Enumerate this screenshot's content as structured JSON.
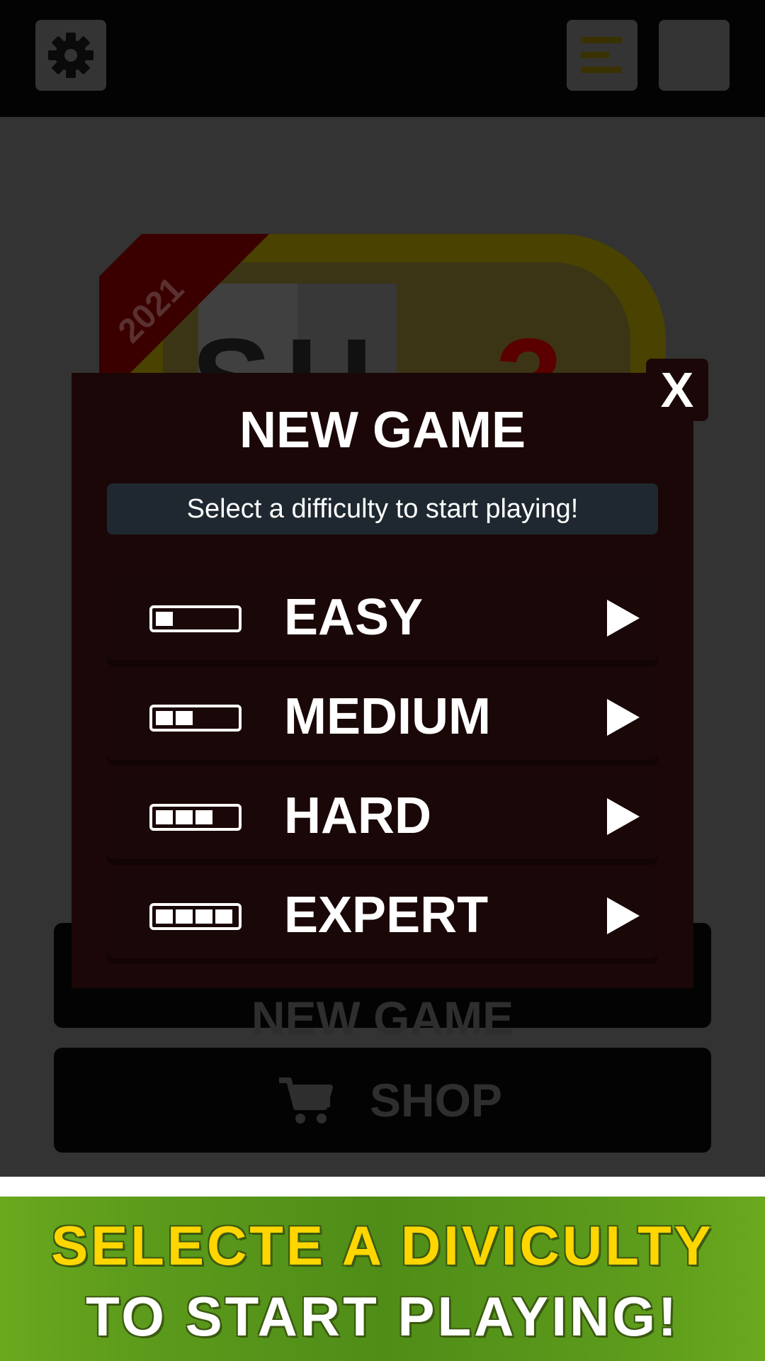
{
  "topbar": {
    "icons": [
      "gear-icon",
      "menu-icon"
    ]
  },
  "background": {
    "logo": {
      "year": "2021",
      "letters": "SU",
      "digit": "3"
    },
    "new_game_label": "NEW GAME",
    "shop_label": "SHOP"
  },
  "modal": {
    "title": "NEW GAME",
    "subtitle": "Select a difficulty to start playing!",
    "close_label": "X",
    "difficulties": [
      {
        "label": "EASY",
        "level": 1
      },
      {
        "label": "MEDIUM",
        "level": 2
      },
      {
        "label": "HARD",
        "level": 3
      },
      {
        "label": "EXPERT",
        "level": 4
      }
    ]
  },
  "banner": {
    "line1": "SELECTE A DIVICULTY",
    "line2": "TO START PLAYING!"
  },
  "colors": {
    "modal_bg": "#1b0707",
    "subtitle_bg": "#1f2830",
    "banner_yellow": "#ffd600",
    "banner_green": "#5b9a1b"
  }
}
